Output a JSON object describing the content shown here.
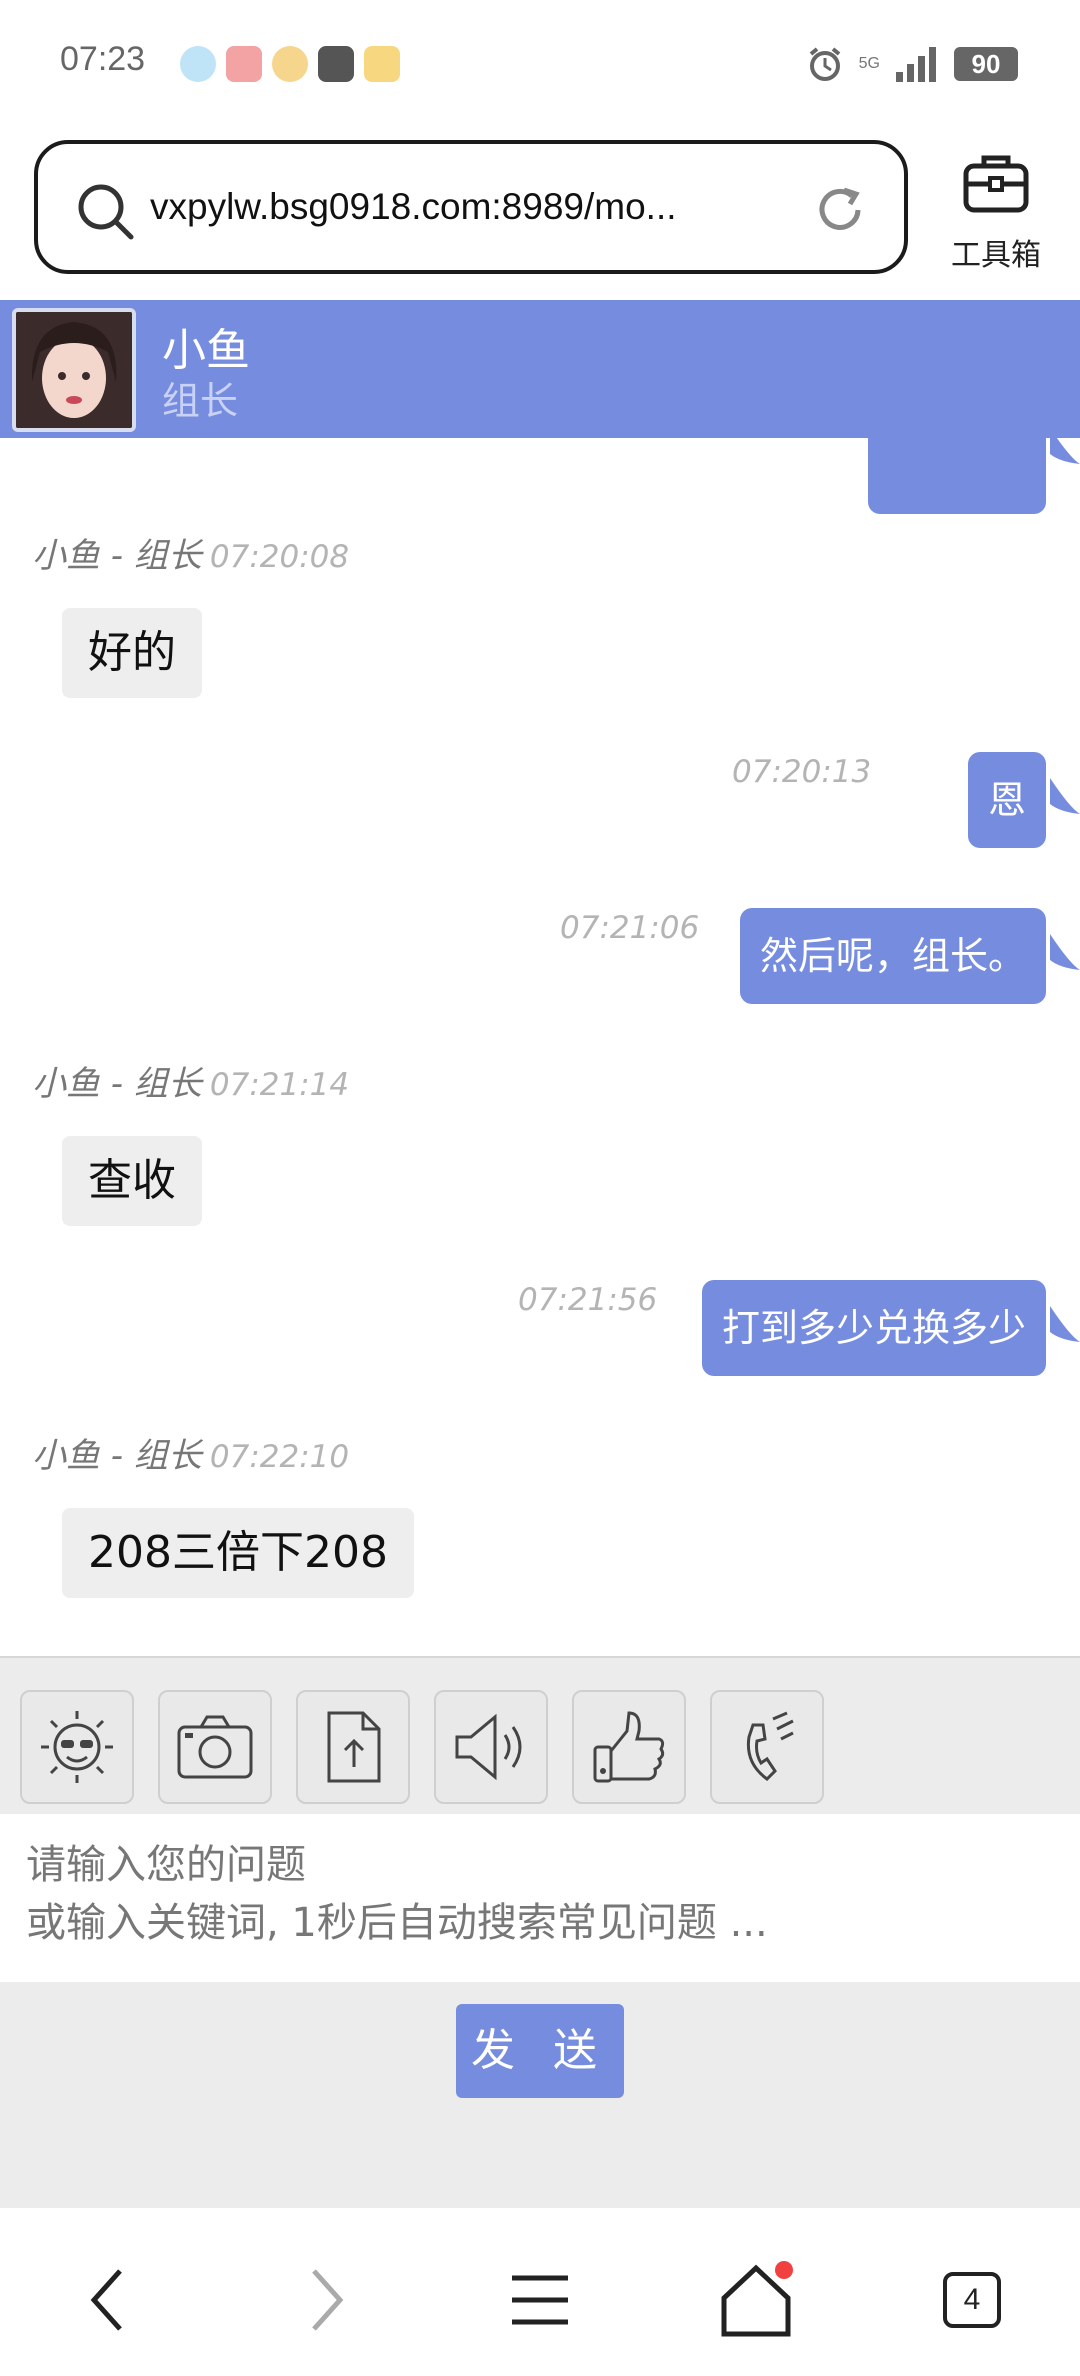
{
  "status_bar": {
    "time": "07:23",
    "network": "5G",
    "battery": "90"
  },
  "browser": {
    "url": "vxpylw.bsg0918.com:8989/mo...",
    "toolbox_label": "工具箱"
  },
  "chat_header": {
    "agent_name": "小鱼",
    "agent_role": "组长"
  },
  "messages": [
    {
      "side": "in",
      "sender": "小鱼 - 组长",
      "time": "07:20:08",
      "text": "好的"
    },
    {
      "side": "out",
      "time": "07:20:13",
      "text": "恩"
    },
    {
      "side": "out",
      "time": "07:21:06",
      "text": "然后呢，组长。"
    },
    {
      "side": "in",
      "sender": "小鱼 - 组长",
      "time": "07:21:14",
      "text": "查收"
    },
    {
      "side": "out",
      "time": "07:21:56",
      "text": "打到多少兑换多少"
    },
    {
      "side": "in",
      "sender": "小鱼 - 组长",
      "time": "07:22:10",
      "text": "208三倍下208"
    }
  ],
  "toolbar": {
    "tools": [
      "emoji-icon",
      "camera-icon",
      "file-upload-icon",
      "voice-icon",
      "thumbs-up-icon",
      "phone-icon"
    ]
  },
  "input": {
    "placeholder": "请输入您的问题\n或输入关键词, 1秒后自动搜索常见问题 ..."
  },
  "send_label": "发 送",
  "bottom_nav": {
    "tab_count": "4",
    "items": [
      "back-icon",
      "forward-icon",
      "menu-icon",
      "home-icon",
      "tabs-icon"
    ]
  },
  "colors": {
    "accent": "#768ddf",
    "incoming_bubble": "#eeeeee",
    "toolbar_bg": "#ececec"
  }
}
